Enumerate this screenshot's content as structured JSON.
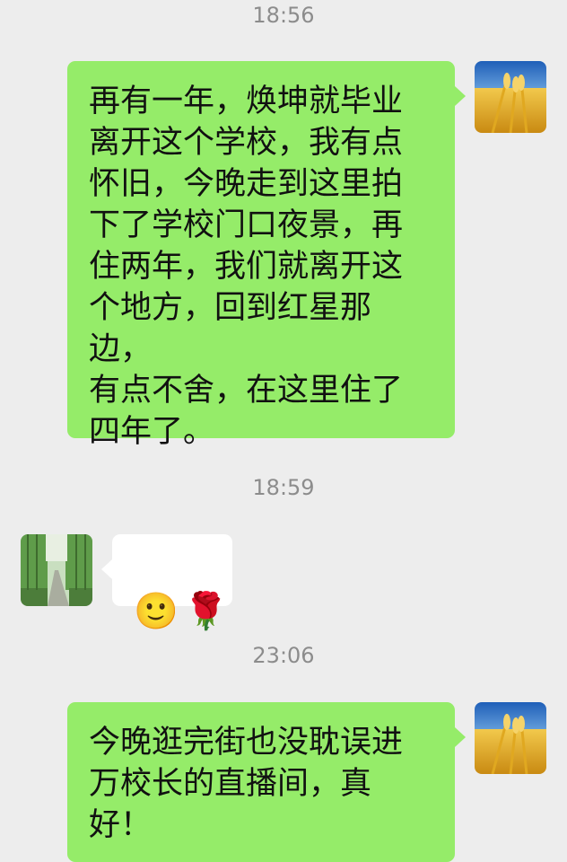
{
  "messages": [
    {
      "timestamp": "18:56",
      "side": "right",
      "avatar": "wheat-field-avatar",
      "text": "再有一年，焕坤就毕业\n离开这个学校，我有点\n怀旧，今晚走到这里拍\n下了学校门口夜景，再\n住两年，我们就离开这\n个地方，回到红星那边，\n有点不舍，在这里住了\n四年了。"
    },
    {
      "timestamp": "18:59",
      "side": "left",
      "avatar": "tree-lined-road-avatar",
      "emojis": [
        "🙂",
        "🌹"
      ]
    },
    {
      "timestamp": "23:06",
      "side": "right",
      "avatar": "wheat-field-avatar",
      "text": "今晚逛完街也没耽误进\n万校长的直播间，真\n好！"
    }
  ],
  "colors": {
    "background": "#ededed",
    "own_bubble": "#95ec69",
    "other_bubble": "#ffffff",
    "timestamp": "#8c8c8c"
  }
}
